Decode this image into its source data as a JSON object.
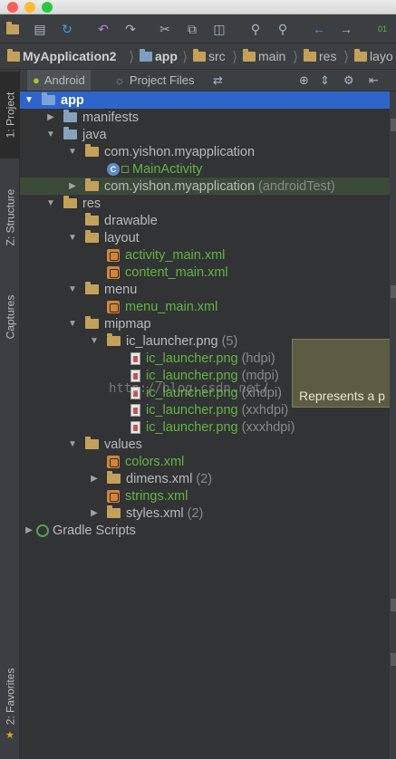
{
  "window": {
    "title": ""
  },
  "breadcrumb": {
    "items": [
      "MyApplication2",
      "app",
      "src",
      "main",
      "res",
      "layo"
    ]
  },
  "panel": {
    "tabs": [
      "Android",
      "Project Files"
    ]
  },
  "sidebar": {
    "project_label": "1: Project",
    "structure_label": "Z: Structure",
    "captures_label": "Captures",
    "favorites_label": "2: Favorites"
  },
  "tree": {
    "app": "app",
    "manifests": "manifests",
    "java": "java",
    "pkg_main": "com.yishon.myapplication",
    "main_activity": "MainActivity",
    "pkg_test": "com.yishon.myapplication",
    "pkg_test_hint": "(androidTest)",
    "res": "res",
    "drawable": "drawable",
    "layout": "layout",
    "activity_main": "activity_main.xml",
    "content_main": "content_main.xml",
    "menu": "menu",
    "menu_main": "menu_main.xml",
    "mipmap": "mipmap",
    "ic_launcher_group": "ic_launcher.png",
    "ic_launcher_group_count": "(5)",
    "ic_launchers": [
      {
        "name": "ic_launcher.png",
        "density": "(hdpi)"
      },
      {
        "name": "ic_launcher.png",
        "density": "(mdpi)"
      },
      {
        "name": "ic_launcher.png",
        "density": "(xhdpi)"
      },
      {
        "name": "ic_launcher.png",
        "density": "(xxhdpi)"
      },
      {
        "name": "ic_launcher.png",
        "density": "(xxxhdpi)"
      }
    ],
    "values": "values",
    "colors": "colors.xml",
    "dimens": "dimens.xml",
    "dimens_count": "(2)",
    "strings": "strings.xml",
    "styles": "styles.xml",
    "styles_count": "(2)",
    "gradle": "Gradle Scripts"
  },
  "tooltip": {
    "text": "Represents a p"
  },
  "watermark": {
    "text": "http://blog.csdn.net/"
  },
  "colors": {
    "selection": "#2f65ca",
    "green_text": "#62b543",
    "background": "#313335"
  }
}
